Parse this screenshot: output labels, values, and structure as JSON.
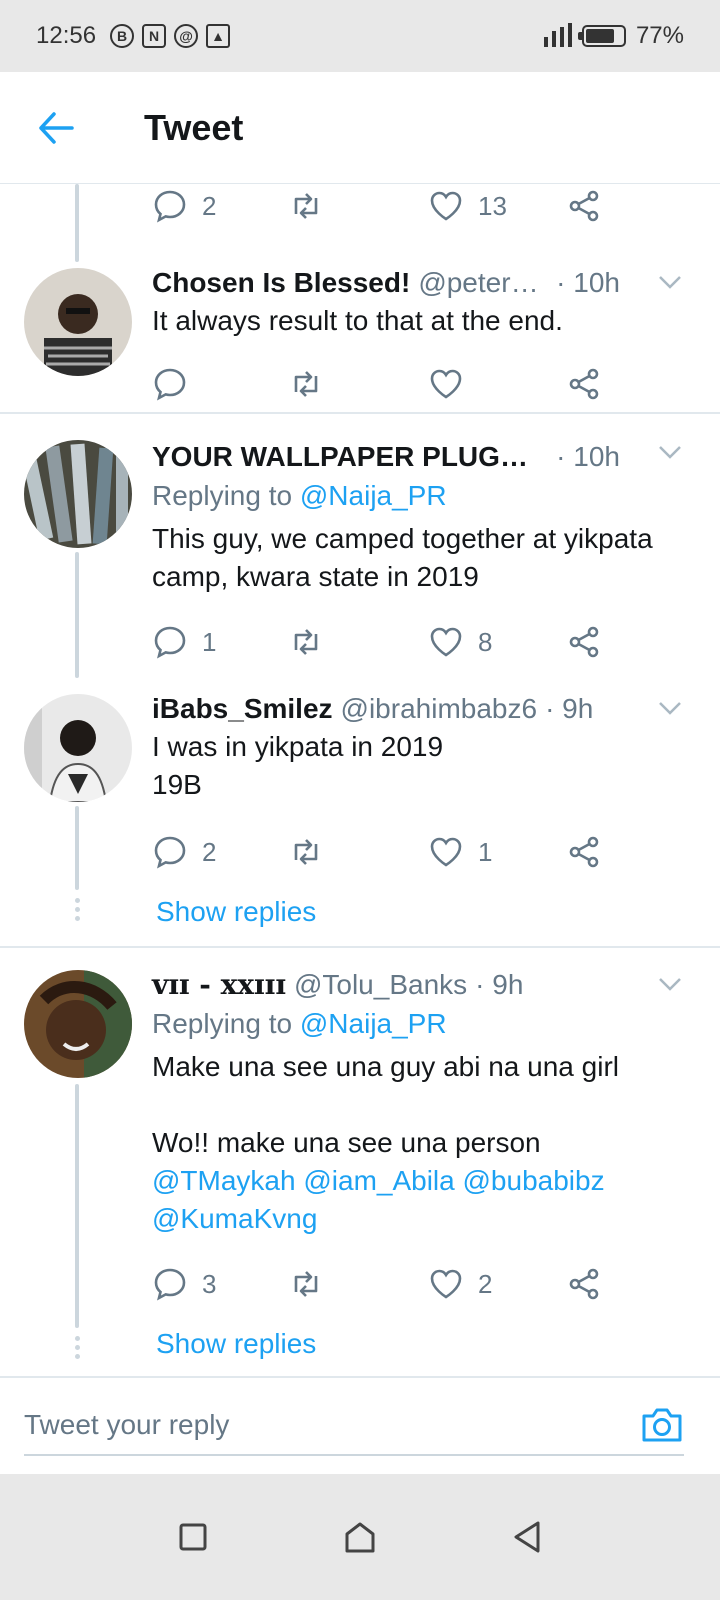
{
  "status_bar": {
    "time": "12:56",
    "icons": [
      "b-icon",
      "n-icon",
      "whirl-icon",
      "gallery-icon"
    ],
    "battery": "77%",
    "battery_level": 0.77
  },
  "header": {
    "title": "Tweet"
  },
  "top_actions": {
    "reply_count": "2",
    "like_count": "13"
  },
  "tweets": [
    {
      "name": "Chosen Is Blessed!",
      "handle": "@petereg...",
      "time": "· 10h",
      "text": "It always result to that at the end.",
      "reply_count": "",
      "like_count": ""
    },
    {
      "name": "YOUR WALLPAPER PLUG⚪ ...",
      "handle": "",
      "time": "· 10h",
      "replying_prefix": "Replying to",
      "replying_to": "@Naija_PR",
      "text": "This guy, we camped together at yikpata camp, kwara state in 2019",
      "reply_count": "1",
      "like_count": "8"
    },
    {
      "name": "iBabs_Smilez",
      "handle": "@ibrahimbabz6",
      "time": "· 9h",
      "text_line1": "I was in yikpata in 2019",
      "text_line2": "19B",
      "reply_count": "2",
      "like_count": "1",
      "show_replies": "Show replies"
    },
    {
      "name": "ᴠɪɪ - xxɪɪɪ",
      "handle": "@Tolu_Banks",
      "time": "· 9h",
      "replying_prefix": "Replying to",
      "replying_to": "@Naija_PR",
      "text_line1": "Make una see una guy abi na una girl",
      "text_line2": "Wo!! make una see una person",
      "mentions_line1": "@TMaykah @iam_Abila @bubabibz",
      "mentions_line2": "@KumaKvng",
      "reply_count": "3",
      "like_count": "2",
      "show_replies": "Show replies"
    }
  ],
  "reply_bar": {
    "placeholder": "Tweet your reply"
  },
  "colors": {
    "accent": "#1da1f2",
    "secondary_text": "#657786",
    "divider": "#e1e8ed"
  }
}
